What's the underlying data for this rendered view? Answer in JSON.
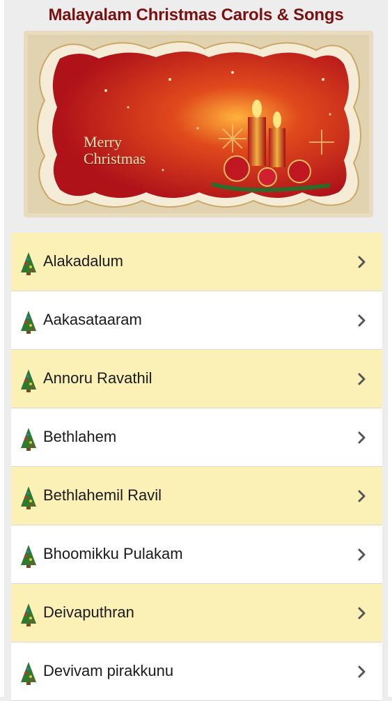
{
  "header": {
    "title": "Malayalam Christmas Carols & Songs"
  },
  "banner": {
    "line1": "Merry",
    "line2": "Christmas"
  },
  "theme": {
    "title_color": "#7a1010",
    "row_alt": "#fbf1b7",
    "row_plain": "#ffffff",
    "banner_red": "#b5121b",
    "banner_frame": "#e8dcc0"
  },
  "songs": [
    {
      "label": "Alakadalum",
      "icon": "christmas-tree-icon"
    },
    {
      "label": "Aakasataaram",
      "icon": "christmas-tree-icon"
    },
    {
      "label": "Annoru Ravathil",
      "icon": "christmas-tree-icon"
    },
    {
      "label": "Bethlahem",
      "icon": "christmas-tree-icon"
    },
    {
      "label": "Bethlahemil Ravil",
      "icon": "christmas-tree-icon"
    },
    {
      "label": "Bhoomikku Pulakam",
      "icon": "christmas-tree-icon"
    },
    {
      "label": "Deivaputhran",
      "icon": "christmas-tree-icon"
    },
    {
      "label": "Devivam pirakkunu",
      "icon": "christmas-tree-icon"
    }
  ]
}
